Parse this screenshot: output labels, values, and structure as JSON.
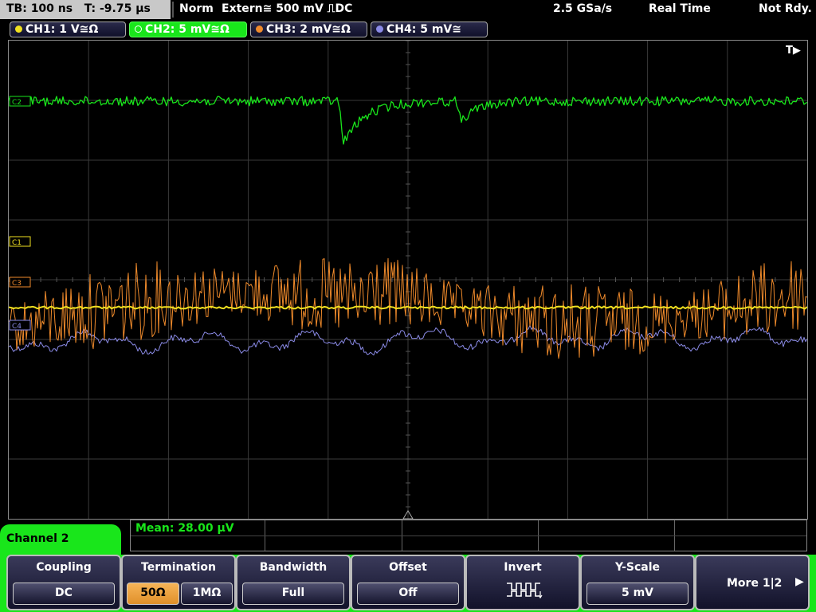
{
  "status": {
    "timebase": "TB: 100 ns",
    "trigger_time": "T: -9.75 µs",
    "mode": "Norm",
    "trigger_source": "Extern≅ 500 mV ⎍DC",
    "sample_rate": "2.5 GSa/s",
    "acquisition": "Real Time",
    "state": "Not Rdy."
  },
  "channels": [
    {
      "label": "CH1: 1 V≅Ω",
      "color": "#f0e020",
      "active": false
    },
    {
      "label": "CH2: 5 mV≅Ω",
      "color": "#19e61b",
      "active": true
    },
    {
      "label": "CH3: 2 mV≅Ω",
      "color": "#ef8a2b",
      "active": false
    },
    {
      "label": "CH4: 5 mV≅",
      "color": "#8a8ae6",
      "active": false
    }
  ],
  "plot": {
    "trigger_marker": "T▶",
    "markers": {
      "c1": "C1",
      "c3": "C3",
      "c4": "C4",
      "c2": "C2"
    },
    "colors": {
      "ch1": "#f0e020",
      "ch2": "#19e61b",
      "ch3": "#ef8a2b",
      "ch4": "#8a8ae6",
      "grid": "#3a3a3a"
    }
  },
  "measurement": {
    "mean": "Mean: 28.00 µV"
  },
  "menu": {
    "channel_title": "Channel 2",
    "coupling": {
      "title": "Coupling",
      "value": "DC"
    },
    "termination": {
      "title": "Termination",
      "opt1": "50Ω",
      "opt2": "1MΩ",
      "selected": "50Ω"
    },
    "bandwidth": {
      "title": "Bandwidth",
      "value": "Full"
    },
    "offset": {
      "title": "Offset",
      "value": "Off"
    },
    "invert": {
      "title": "Invert"
    },
    "yscale": {
      "title": "Y-Scale",
      "value": "5 mV"
    },
    "more": {
      "label": "More 1|2"
    }
  }
}
